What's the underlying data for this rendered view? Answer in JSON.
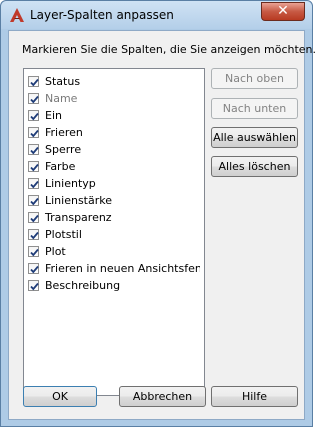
{
  "window": {
    "title": "Layer-Spalten anpassen",
    "close_glyph": "✕",
    "icon": "autocad-icon",
    "accent_color": "#c0392b"
  },
  "instruction": "Markieren Sie die Spalten, die Sie anzeigen möchten.",
  "columns": [
    {
      "label": "Status",
      "checked": true,
      "enabled": true
    },
    {
      "label": "Name",
      "checked": true,
      "enabled": false
    },
    {
      "label": "Ein",
      "checked": true,
      "enabled": true
    },
    {
      "label": "Frieren",
      "checked": true,
      "enabled": true
    },
    {
      "label": "Sperre",
      "checked": true,
      "enabled": true
    },
    {
      "label": "Farbe",
      "checked": true,
      "enabled": true
    },
    {
      "label": "Linientyp",
      "checked": true,
      "enabled": true
    },
    {
      "label": "Linienstärke",
      "checked": true,
      "enabled": true
    },
    {
      "label": "Transparenz",
      "checked": true,
      "enabled": true
    },
    {
      "label": "Plotstil",
      "checked": true,
      "enabled": true
    },
    {
      "label": "Plot",
      "checked": true,
      "enabled": true
    },
    {
      "label": "Frieren in neuen Ansichtsfenst...",
      "checked": true,
      "enabled": true
    },
    {
      "label": "Beschreibung",
      "checked": true,
      "enabled": true
    }
  ],
  "side_buttons": {
    "move_up": "Nach oben",
    "move_down": "Nach unten",
    "select_all": "Alle auswählen",
    "clear_all": "Alles löschen"
  },
  "footer_buttons": {
    "ok": "OK",
    "cancel": "Abbrechen",
    "help": "Hilfe"
  }
}
